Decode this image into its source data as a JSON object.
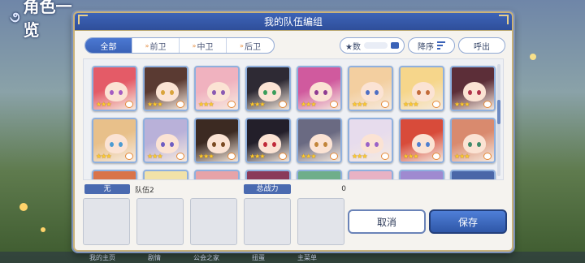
{
  "background": {
    "title": "角色一览",
    "bottom_labels": [
      "我的主页",
      "剧情",
      "公会之家",
      "扭蛋",
      "主菜单"
    ]
  },
  "dialog": {
    "title": "我的队伍编组",
    "tabs": [
      {
        "label": "全部",
        "active": true
      },
      {
        "label": "前卫",
        "active": false
      },
      {
        "label": "中卫",
        "active": false
      },
      {
        "label": "后卫",
        "active": false
      }
    ],
    "sort_label": "★数",
    "order_label": "降序",
    "call_label": "呼出",
    "characters": [
      {
        "stars": 3,
        "hair": "#e45b67",
        "eyes": "#a45cc2"
      },
      {
        "stars": 3,
        "hair": "#5a3a32",
        "eyes": "#d9a43c"
      },
      {
        "stars": 3,
        "hair": "#f0b2bf",
        "eyes": "#8a5ab2"
      },
      {
        "stars": 3,
        "hair": "#2e2a34",
        "eyes": "#3a9e5a"
      },
      {
        "stars": 3,
        "hair": "#d05a9e",
        "eyes": "#8e3a92"
      },
      {
        "stars": 3,
        "hair": "#f3cfa0",
        "eyes": "#4f6fc4"
      },
      {
        "stars": 3,
        "hair": "#f6d68b",
        "eyes": "#c36b3a"
      },
      {
        "stars": 3,
        "hair": "#5c2e38",
        "eyes": "#b0324a"
      },
      {
        "stars": 3,
        "hair": "#e8c08a",
        "eyes": "#4c9bd2"
      },
      {
        "stars": 3,
        "hair": "#b9b1d9",
        "eyes": "#6e5dc2"
      },
      {
        "stars": 3,
        "hair": "#3c2a22",
        "eyes": "#7a4a22"
      },
      {
        "stars": 3,
        "hair": "#231f2a",
        "eyes": "#c02a3a"
      },
      {
        "stars": 3,
        "hair": "#6a6a82",
        "eyes": "#c2853a"
      },
      {
        "stars": 3,
        "hair": "#e7dced",
        "eyes": "#9a62c8"
      },
      {
        "stars": 3,
        "hair": "#d84b3a",
        "eyes": "#4f7fd0"
      },
      {
        "stars": 3,
        "hair": "#d98a6e",
        "eyes": "#3f8a6a"
      },
      {
        "stars": 0,
        "hair": "#d9744a",
        "eyes": "#333"
      },
      {
        "stars": 0,
        "hair": "#f1e2a8",
        "eyes": "#333"
      },
      {
        "stars": 0,
        "hair": "#e7a3a8",
        "eyes": "#333"
      },
      {
        "stars": 0,
        "hair": "#8a3a5a",
        "eyes": "#333"
      },
      {
        "stars": 0,
        "hair": "#6fae8a",
        "eyes": "#333"
      },
      {
        "stars": 0,
        "hair": "#e8b2c4",
        "eyes": "#333"
      },
      {
        "stars": 0,
        "hair": "#9f8ad0",
        "eyes": "#333"
      },
      {
        "stars": 0,
        "hair": "#4a67a8",
        "eyes": "#333"
      }
    ],
    "team_badge": "无",
    "team_name": "队伍2",
    "power_label": "总战力",
    "power_value": "0",
    "slots": 5,
    "cancel_label": "取消",
    "save_label": "保存"
  },
  "colors": {
    "header": "#2f4f9a",
    "accent_gold": "#c9b27b",
    "save": "#2f57a7"
  }
}
